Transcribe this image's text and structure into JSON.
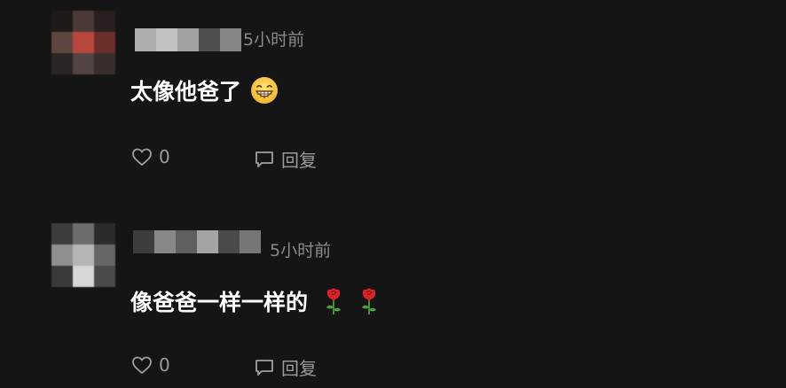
{
  "comments": [
    {
      "time": "5小时前",
      "text": "太像他爸了",
      "emoji": "grinning-face-icon",
      "likes": "0",
      "reply_label": "回复",
      "avatar_colors": [
        "#1f1a19",
        "#4b3a37",
        "#2a1f1e",
        "#5d4540",
        "#b8473e",
        "#6a2f2a",
        "#2b2625",
        "#524443",
        "#3a2e2d"
      ],
      "username_colors": [
        "#c9c9c9",
        "#e0e0e0",
        "#b9b9b9",
        "#5a5a5a",
        "#9a9a9a"
      ]
    },
    {
      "time": "5小时前",
      "text": "像爸爸一样一样的",
      "emoji": "rose-icon",
      "likes": "0",
      "reply_label": "回复",
      "avatar_colors": [
        "#3d3d3d",
        "#6d6d6d",
        "#2b2b2b",
        "#8f8f8f",
        "#b5b5b5",
        "#666666",
        "#3a3a3a",
        "#d7d7d7",
        "#4a4a4a"
      ],
      "username_colors": [
        "#444444",
        "#9d9d9d",
        "#6c6c6c",
        "#bebebe",
        "#545454",
        "#888888"
      ]
    }
  ],
  "colors": {
    "background": "#151515",
    "text": "#ffffff",
    "meta": "#8a8a8a"
  }
}
